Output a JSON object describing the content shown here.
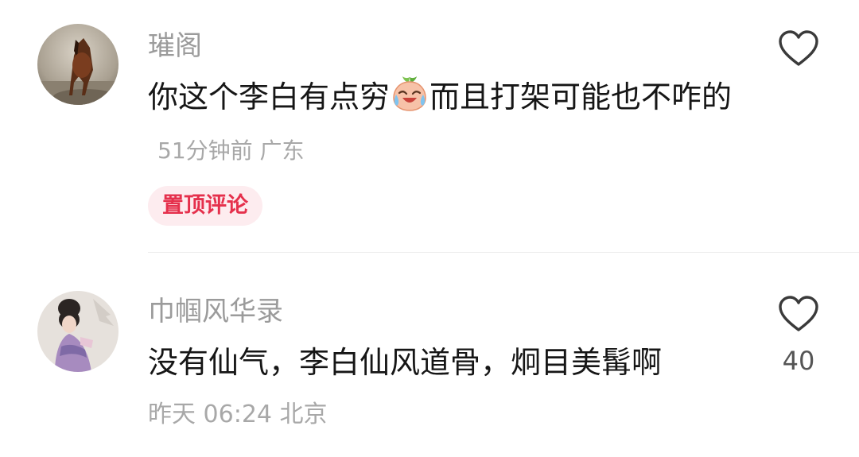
{
  "comments": [
    {
      "username": "璀阁",
      "text_before_emoji": "你这个李白有点穷",
      "text_after_emoji": "而且打架可能也不咋的",
      "time": "51分钟前",
      "location": "广东",
      "badge": "置顶评论",
      "avatar": "horse-avatar",
      "emoji": "crying-laughing-peach-emoji",
      "like_icon": "heart-outline-icon",
      "like_count": ""
    },
    {
      "username": "巾帼风华录",
      "text": "没有仙气，李白仙风道骨，炯目美髯啊",
      "time": "昨天 06:24",
      "location": "北京",
      "avatar": "ancient-lady-avatar",
      "like_icon": "heart-outline-icon",
      "like_count": "40"
    }
  ],
  "colors": {
    "username": "#9b9b9b",
    "text": "#161616",
    "meta": "#a8a8a8",
    "badge_bg": "#fdecef",
    "badge_text": "#e5304c"
  }
}
